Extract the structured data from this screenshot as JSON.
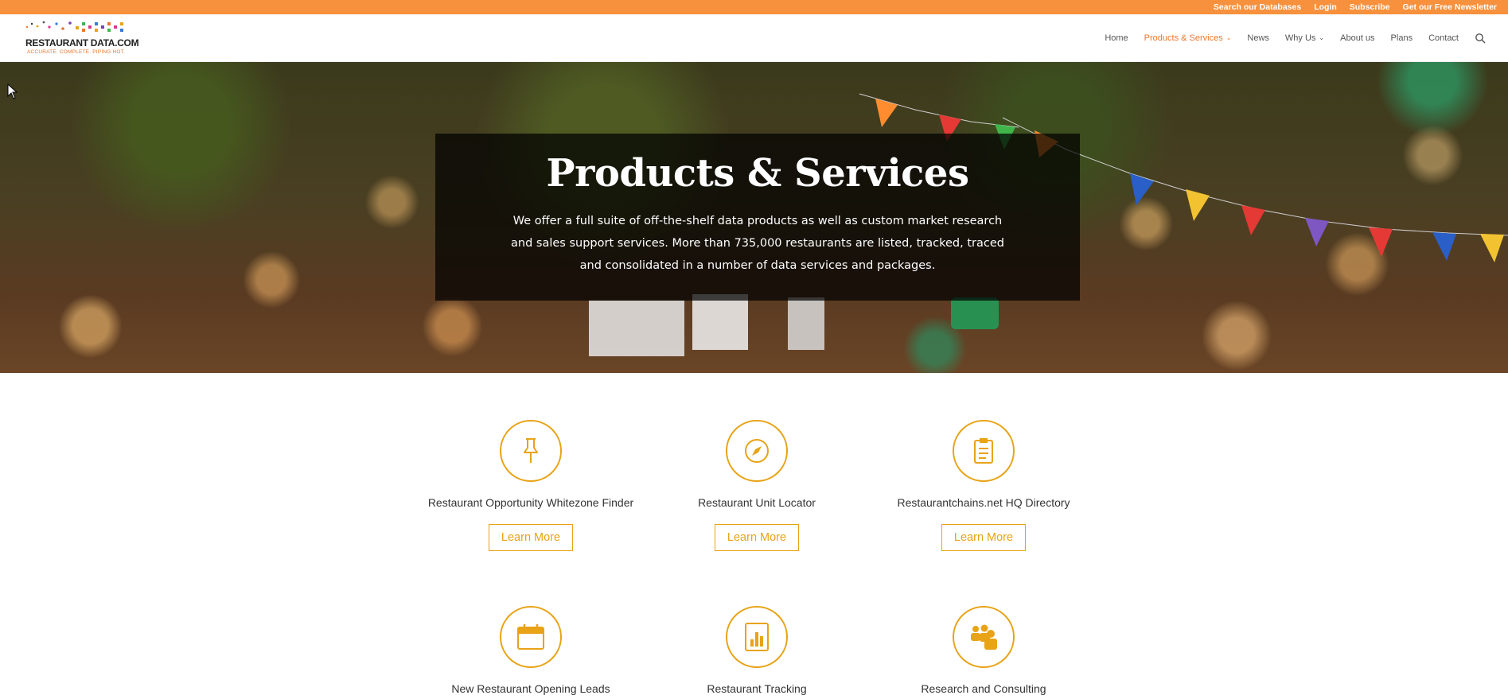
{
  "topbar": {
    "links": [
      "Search our Databases",
      "Login",
      "Subscribe",
      "Get our Free Newsletter"
    ]
  },
  "logo": {
    "name": "RESTAURANT DATA.COM",
    "tagline": "ACCURATE. COMPLETE. PIPING HOT."
  },
  "nav": {
    "items": [
      {
        "label": "Home"
      },
      {
        "label": "Products & Services",
        "active": true,
        "dropdown": true
      },
      {
        "label": "News"
      },
      {
        "label": "Why Us",
        "dropdown": true
      },
      {
        "label": "About us"
      },
      {
        "label": "Plans"
      },
      {
        "label": "Contact"
      }
    ],
    "search_icon": "search-icon"
  },
  "hero": {
    "title": "Products & Services",
    "text": "We offer a full suite of off-the-shelf data products as well as custom market research and sales support services. More than 735,000 restaurants are listed, tracked, traced and consolidated in a number of data services and packages."
  },
  "services": [
    {
      "title": "Restaurant Opportunity Whitezone Finder",
      "button": "Learn More",
      "icon": "pushpin-icon"
    },
    {
      "title": "Restaurant Unit Locator",
      "button": "Learn More",
      "icon": "compass-icon"
    },
    {
      "title": "Restaurantchains.net HQ Directory",
      "button": "Learn More",
      "icon": "clipboard-icon"
    },
    {
      "title": "New Restaurant Opening Leads",
      "icon": "calendar-icon"
    },
    {
      "title": "Restaurant Tracking",
      "icon": "bar-chart-icon"
    },
    {
      "title": "Research and Consulting",
      "icon": "people-icon"
    }
  ],
  "colors": {
    "accent_orange": "#f7913d",
    "nav_active": "#e8772e",
    "icon_gold": "#e8a317"
  }
}
